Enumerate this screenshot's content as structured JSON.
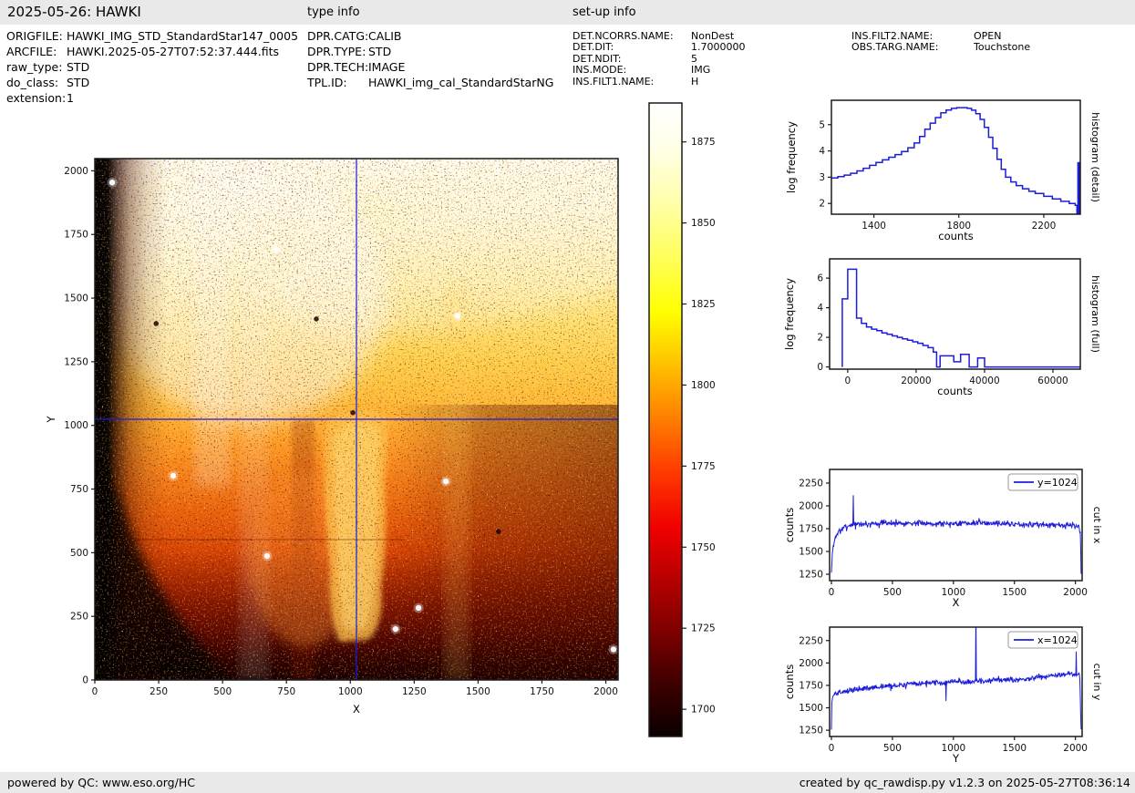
{
  "header": {
    "title": "2025-05-26: HAWKI",
    "type_info_label": "type info",
    "setup_info_label": "set-up info"
  },
  "metadata": {
    "file_info": [
      [
        "ORIGFILE:",
        "HAWKI_IMG_STD_StandardStar147_0005"
      ],
      [
        "ARCFILE:",
        "HAWKI.2025-05-27T07:52:37.444.fits"
      ],
      [
        "raw_type:",
        "STD"
      ],
      [
        "do_class:",
        "STD"
      ],
      [
        "extension:",
        "1"
      ]
    ],
    "type_info": [
      [
        "DPR.CATG:",
        "CALIB"
      ],
      [
        "DPR.TYPE:",
        "STD"
      ],
      [
        "DPR.TECH:",
        "IMAGE"
      ],
      [
        "TPL.ID:",
        "HAWKI_img_cal_StandardStarNG"
      ]
    ],
    "setup_info": [
      [
        "DET.NCORRS.NAME:",
        "NonDest"
      ],
      [
        "DET.DIT:",
        "1.7000000"
      ],
      [
        "DET.NDIT:",
        "5"
      ],
      [
        "INS.MODE:",
        "IMG"
      ],
      [
        "INS.FILT1.NAME:",
        "H"
      ]
    ],
    "setup_info2": [
      [
        "INS.FILT2.NAME:",
        "OPEN"
      ],
      [
        "OBS.TARG.NAME:",
        "Touchstone"
      ]
    ]
  },
  "footer": {
    "left": "powered by QC: www.eso.org/HC",
    "right": "created by qc_rawdisp.py v1.2.3 on 2025-05-27T08:36:14"
  },
  "colors": {
    "line_blue": "#1c1cdb",
    "axis_dark": "#1a1a1a",
    "bar_bg": "#e9e9e9"
  },
  "chart_data": [
    {
      "id": "main_image",
      "type": "heatmap",
      "xlabel": "X",
      "ylabel": "Y",
      "xlim": [
        0,
        2048
      ],
      "ylim": [
        0,
        2048
      ],
      "xticks": [
        0,
        250,
        500,
        750,
        1000,
        1250,
        1500,
        1750,
        2000
      ],
      "yticks": [
        0,
        250,
        500,
        750,
        1000,
        1250,
        1500,
        1750,
        2000
      ],
      "colormap": "hot",
      "crosshair": {
        "x": 1024,
        "y": 1024
      },
      "colorbar": {
        "range": [
          1691.6,
          1887.0
        ],
        "ticks": [
          1700,
          1725,
          1750,
          1775,
          1800,
          1825,
          1850,
          1875
        ]
      },
      "bright_spots": [
        [
          68,
          1954
        ],
        [
          674,
          487
        ],
        [
          1374,
          780
        ],
        [
          1267,
          283
        ],
        [
          1177,
          200
        ],
        [
          307,
          802
        ],
        [
          710,
          1693
        ],
        [
          2030,
          120
        ],
        [
          1420,
          1430
        ]
      ],
      "dark_spots": [
        [
          867,
          1418
        ],
        [
          1580,
          583
        ],
        [
          240,
          1400
        ],
        [
          1010,
          1050
        ]
      ]
    },
    {
      "id": "hist_detail",
      "type": "step",
      "xlabel": "counts",
      "ylabel": "log frequency",
      "right_label": "histogram (detail)",
      "xlim": [
        1200,
        2372
      ],
      "ylim": [
        1.59,
        5.93
      ],
      "xticks": [
        1400,
        1800,
        2200
      ],
      "yticks": [
        2,
        3,
        4,
        5
      ],
      "bins": [
        [
          1200,
          2.97
        ],
        [
          1230,
          3.02
        ],
        [
          1260,
          3.08
        ],
        [
          1290,
          3.15
        ],
        [
          1320,
          3.24
        ],
        [
          1350,
          3.34
        ],
        [
          1380,
          3.45
        ],
        [
          1410,
          3.56
        ],
        [
          1440,
          3.66
        ],
        [
          1470,
          3.76
        ],
        [
          1500,
          3.86
        ],
        [
          1530,
          3.98
        ],
        [
          1560,
          4.12
        ],
        [
          1590,
          4.3
        ],
        [
          1615,
          4.55
        ],
        [
          1640,
          4.83
        ],
        [
          1665,
          5.06
        ],
        [
          1690,
          5.27
        ],
        [
          1715,
          5.45
        ],
        [
          1740,
          5.56
        ],
        [
          1765,
          5.62
        ],
        [
          1790,
          5.65
        ],
        [
          1840,
          5.62
        ],
        [
          1860,
          5.55
        ],
        [
          1880,
          5.42
        ],
        [
          1900,
          5.2
        ],
        [
          1920,
          4.9
        ],
        [
          1940,
          4.52
        ],
        [
          1960,
          4.1
        ],
        [
          1980,
          3.68
        ],
        [
          2000,
          3.3
        ],
        [
          2020,
          3.0
        ],
        [
          2045,
          2.82
        ],
        [
          2070,
          2.68
        ],
        [
          2100,
          2.56
        ],
        [
          2130,
          2.46
        ],
        [
          2160,
          2.38
        ],
        [
          2200,
          2.27
        ],
        [
          2240,
          2.17
        ],
        [
          2280,
          2.08
        ],
        [
          2320,
          2.0
        ],
        [
          2348,
          1.93
        ],
        [
          2356,
          1.62
        ],
        [
          2361,
          3.55
        ],
        [
          2367,
          1.62
        ]
      ]
    },
    {
      "id": "hist_full",
      "type": "step",
      "xlabel": "counts",
      "ylabel": "log frequency",
      "right_label": "histogram (full)",
      "xlim": [
        -5300,
        68000
      ],
      "ylim": [
        -0.15,
        7.3
      ],
      "xticks": [
        0,
        20000,
        40000,
        60000
      ],
      "yticks": [
        0,
        2,
        4,
        6
      ],
      "bins": [
        [
          -1600,
          0
        ],
        [
          -1600,
          4.6
        ],
        [
          0,
          4.6
        ],
        [
          0,
          6.6
        ],
        [
          2600,
          6.6
        ],
        [
          2600,
          3.3
        ],
        [
          4000,
          3.3
        ],
        [
          4000,
          2.95
        ],
        [
          5500,
          2.95
        ],
        [
          5500,
          2.7
        ],
        [
          7000,
          2.7
        ],
        [
          7000,
          2.55
        ],
        [
          8500,
          2.55
        ],
        [
          8500,
          2.45
        ],
        [
          10000,
          2.45
        ],
        [
          10000,
          2.3
        ],
        [
          11500,
          2.3
        ],
        [
          11500,
          2.2
        ],
        [
          13000,
          2.2
        ],
        [
          13000,
          2.1
        ],
        [
          14500,
          2.1
        ],
        [
          14500,
          2.0
        ],
        [
          16000,
          2.0
        ],
        [
          16000,
          1.9
        ],
        [
          17500,
          1.9
        ],
        [
          17500,
          1.8
        ],
        [
          19000,
          1.8
        ],
        [
          19000,
          1.7
        ],
        [
          20500,
          1.7
        ],
        [
          20500,
          1.6
        ],
        [
          22000,
          1.6
        ],
        [
          22000,
          1.45
        ],
        [
          23500,
          1.45
        ],
        [
          23500,
          1.3
        ],
        [
          25000,
          1.3
        ],
        [
          25000,
          1.0
        ],
        [
          26000,
          1.0
        ],
        [
          26000,
          0
        ],
        [
          27000,
          0
        ],
        [
          27000,
          0.75
        ],
        [
          31000,
          0.75
        ],
        [
          31000,
          0.35
        ],
        [
          33000,
          0.35
        ],
        [
          33000,
          0.85
        ],
        [
          35500,
          0.85
        ],
        [
          35500,
          0
        ],
        [
          38000,
          0
        ],
        [
          38000,
          0.6
        ],
        [
          40000,
          0.6
        ],
        [
          40000,
          0
        ]
      ]
    },
    {
      "id": "cut_x",
      "type": "noisy_line",
      "xlabel": "X",
      "ylabel": "counts",
      "right_label": "cut in x",
      "legend": "y=1024",
      "xlim": [
        -15,
        2055
      ],
      "ylim": [
        1180,
        2400
      ],
      "xticks": [
        0,
        500,
        1000,
        1500,
        2000
      ],
      "yticks": [
        1250,
        1500,
        1750,
        2000,
        2250
      ],
      "xdata": [
        0,
        2047
      ],
      "n": 560,
      "seed": 7,
      "noise": 38,
      "trend": [
        [
          0,
          1255
        ],
        [
          6,
          1450
        ],
        [
          15,
          1560
        ],
        [
          30,
          1650
        ],
        [
          60,
          1715
        ],
        [
          100,
          1762
        ],
        [
          150,
          1788
        ],
        [
          250,
          1800
        ],
        [
          500,
          1812
        ],
        [
          900,
          1808
        ],
        [
          1300,
          1812
        ],
        [
          1600,
          1798
        ],
        [
          1900,
          1788
        ],
        [
          2030,
          1775
        ],
        [
          2041,
          1700
        ],
        [
          2047,
          1260
        ]
      ],
      "spikes": [
        [
          178,
          2118
        ]
      ]
    },
    {
      "id": "cut_y",
      "type": "noisy_line",
      "xlabel": "Y",
      "ylabel": "counts",
      "right_label": "cut in y",
      "legend": "x=1024",
      "xlim": [
        -15,
        2055
      ],
      "ylim": [
        1180,
        2400
      ],
      "xticks": [
        0,
        500,
        1000,
        1500,
        2000
      ],
      "yticks": [
        1250,
        1500,
        1750,
        2000,
        2250
      ],
      "xdata": [
        0,
        2047
      ],
      "n": 560,
      "seed": 13,
      "noise": 36,
      "trend": [
        [
          0,
          1258
        ],
        [
          4,
          1600
        ],
        [
          20,
          1648
        ],
        [
          100,
          1678
        ],
        [
          250,
          1712
        ],
        [
          450,
          1740
        ],
        [
          700,
          1768
        ],
        [
          1000,
          1790
        ],
        [
          1300,
          1800
        ],
        [
          1600,
          1822
        ],
        [
          1800,
          1852
        ],
        [
          1950,
          1878
        ],
        [
          2015,
          1868
        ],
        [
          2035,
          1880
        ],
        [
          2047,
          1258
        ]
      ],
      "spikes": [
        [
          940,
          1575
        ],
        [
          1183,
          2600
        ],
        [
          2008,
          2128
        ]
      ]
    }
  ]
}
